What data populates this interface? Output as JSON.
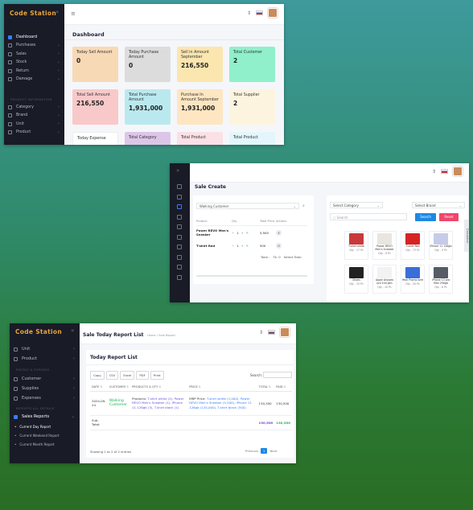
{
  "shot1": {
    "brand": "Code Station",
    "page_title": "Dashboard",
    "nav": [
      "Dashboard",
      "Purchases",
      "Sales",
      "Stock",
      "Return",
      "Damage"
    ],
    "section": "PRODUCT INFORMATION",
    "nav2": [
      "Category",
      "Brand",
      "Unit",
      "Product"
    ],
    "cards": [
      {
        "label": "Today Sell Amount",
        "value": "0",
        "color": "#f8d9b5"
      },
      {
        "label": "Today Purchase Amount",
        "value": "0",
        "color": "#dcdcdc"
      },
      {
        "label": "Sell in Amount September",
        "value": "216,550",
        "color": "#fbe6b0"
      },
      {
        "label": "Total Customer",
        "value": "2",
        "color": "#8ff0cb"
      },
      {
        "label": "Total Sell Amount",
        "value": "216,550",
        "color": "#f9c9c9"
      },
      {
        "label": "Total Purchase Amount",
        "value": "1,931,000",
        "color": "#b9e9ee"
      },
      {
        "label": "Purchase In Amount September",
        "value": "1,931,000",
        "color": "#fde6c1"
      },
      {
        "label": "Total Supplier",
        "value": "2",
        "color": "#fdf4e0"
      },
      {
        "label": "Today Expense",
        "value": "",
        "color": "#ffffff"
      },
      {
        "label": "Total Category",
        "value": "",
        "color": "#dcc6e8"
      },
      {
        "label": "Total Product",
        "value": "",
        "color": "#fbe0e6"
      },
      {
        "label": "Total Product",
        "value": "",
        "color": "#e2f6fb"
      }
    ]
  },
  "shot2": {
    "title": "Sale Create",
    "customer": "Walking Customer",
    "headers": [
      "Product",
      "Qty",
      "Total Price",
      "Actions"
    ],
    "rows": [
      {
        "name": "Power REVO Men's Sneaker",
        "qty": "1",
        "price": "5,500"
      },
      {
        "name": "T-shirt Red",
        "qty": "1",
        "price": "500"
      }
    ],
    "total_label": "Total :",
    "total_value": "Tk. 0",
    "select_label": "Select Total",
    "category_placeholder": "Select Category",
    "brand_placeholder": "Select Brand",
    "search_placeholder": "Search",
    "search_btn": "Search",
    "reset_btn": "Reset",
    "calc_label": "Calculator",
    "products": [
      {
        "name": "T-shirt white",
        "qty": "Qty - 17 Pc",
        "color": "#c8393b"
      },
      {
        "name": "Power REVO Men's Sneaker",
        "qty": "Qty - 9 Pc",
        "color": "#e9e6e0"
      },
      {
        "name": "T-shirt Red",
        "qty": "Qty - 73 Pc",
        "color": "#d62222"
      },
      {
        "name": "iPhone 11 128gb",
        "qty": "Qty - 3 Pc",
        "color": "#c6cce8"
      },
      {
        "name": "Shoes",
        "qty": "Qty - 15 Pc",
        "color": "#222222"
      },
      {
        "name": "Apple Airpods pro 2nd gen",
        "qty": "Qty - 10 Pc",
        "color": "#f2f2f2"
      },
      {
        "name": "Yeon Promo wire",
        "qty": "Qty - 20 Pc",
        "color": "#3a6ed8"
      },
      {
        "name": "iPhone 13 pro Max 256gb",
        "qty": "Qty - 6 Pc",
        "color": "#555c66"
      }
    ]
  },
  "shot3": {
    "brand": "Code Station",
    "header_title": "Sale Today Report List",
    "breadcrumb": "Home  /  Sale Report",
    "nav": [
      "Unit",
      "Product"
    ],
    "section1": "PEOPLE & EXPENSE",
    "nav2": [
      "Customer",
      "Supplies",
      "Expenses"
    ],
    "section2": "REPORTS ALL DETAILS",
    "reports": "Sales Reports",
    "sub": [
      "Current Day Report",
      "Current Weekend Report",
      "Current Month Report"
    ],
    "panel_title": "Today Report List",
    "export_buttons": [
      "Copy",
      "CSV",
      "Excel",
      "PDF",
      "Print"
    ],
    "search_label": "Search:",
    "columns": [
      "DATE",
      "CUSTOMER",
      "PRODUCTS & QTY",
      "PRICE",
      "TOTAL",
      "PAID"
    ],
    "row": {
      "date": "2024-09-24",
      "customer": "Walking Customer",
      "products_prefix": "Products:",
      "products": "T-shirt white (2), Power REVO Men's Sneaker (1), iPhone 11 128gb (3), T-shirt black (1)",
      "price_prefix": "MRP Price:",
      "price": "T-shirt white (1,000), Power REVO Men's Sneaker (5,500), iPhone 11 128gb (120,000), T-shirt black (500)",
      "total": "130,500",
      "paid": "130,500"
    },
    "subtotal_label": "Sub-Total:",
    "subtotal_total": "130,500",
    "subtotal_paid": "130,500",
    "showing": "Showing 1 to 2 of 2 entries",
    "previous": "Previous",
    "page": "1",
    "next": "Next"
  }
}
